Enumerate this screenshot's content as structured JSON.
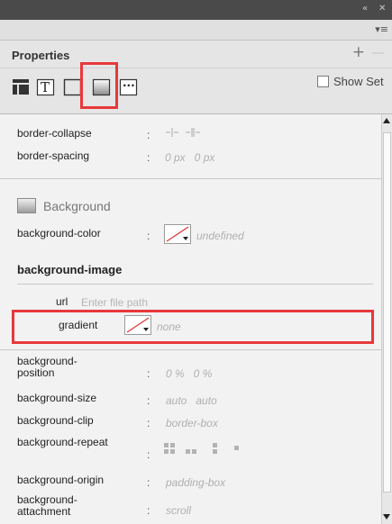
{
  "window": {
    "collapse_glyph": "«",
    "close_glyph": "✕",
    "menu_glyph": "▾≡"
  },
  "panel": {
    "title": "Properties",
    "add_glyph": "+",
    "remove_glyph": "—",
    "show_set_label": "Show Set"
  },
  "toolbar": {
    "icons": [
      "layout-icon",
      "text-icon",
      "border-icon",
      "background-icon",
      "more-icon"
    ],
    "text_icon_glyph": "T",
    "more_icon_glyph": "···",
    "highlighted": "background-icon",
    "highlight_color": "#e8383c"
  },
  "table": {
    "border_collapse_label": "border-collapse",
    "border_spacing_label": "border-spacing",
    "border_spacing_value": "0 px   0 px"
  },
  "background": {
    "section_title": "Background",
    "color_label": "background-color",
    "color_value": "undefined",
    "image_title": "background-image",
    "url_label": "url",
    "url_placeholder": "Enter file path",
    "gradient_label": "gradient",
    "gradient_value": "none",
    "position_label": "background-\nposition",
    "position_value": "0 %   0 %",
    "size_label": "background-size",
    "size_value": "auto   auto",
    "clip_label": "background-clip",
    "clip_value": "border-box",
    "repeat_label": "background-repeat",
    "origin_label": "background-origin",
    "origin_value": "padding-box",
    "attachment_label": "background-\nattachment",
    "attachment_value": "scroll"
  },
  "colon": ":"
}
